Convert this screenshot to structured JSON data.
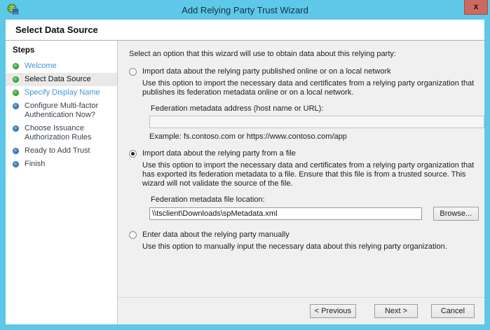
{
  "window": {
    "title": "Add Relying Party Trust Wizard",
    "close_label": "x",
    "page_header": "Select Data Source"
  },
  "sidebar": {
    "title": "Steps",
    "items": [
      {
        "label": "Welcome",
        "bullet": "green",
        "state": "link"
      },
      {
        "label": "Select Data Source",
        "bullet": "green",
        "state": "current"
      },
      {
        "label": "Specify Display Name",
        "bullet": "green",
        "state": "link"
      },
      {
        "label": "Configure Multi-factor Authentication Now?",
        "bullet": "blue",
        "state": "future"
      },
      {
        "label": "Choose Issuance Authorization Rules",
        "bullet": "blue",
        "state": "future"
      },
      {
        "label": "Ready to Add Trust",
        "bullet": "blue",
        "state": "future"
      },
      {
        "label": "Finish",
        "bullet": "blue",
        "state": "future"
      }
    ]
  },
  "main": {
    "intro": "Select an option that this wizard will use to obtain data about this relying party:",
    "option_online": {
      "label": "Import data about the relying party published online or on a local network",
      "description": "Use this option to import the necessary data and certificates from a relying party organization that publishes its federation metadata online or on a local network.",
      "field_label": "Federation metadata address (host name or URL):",
      "field_value": "",
      "example": "Example: fs.contoso.com or https://www.contoso.com/app",
      "selected": false
    },
    "option_file": {
      "label": "Import data about the relying party from a file",
      "description": "Use this option to import the necessary data and certificates from a relying party organization that has exported its federation metadata to a file. Ensure that this file is from a trusted source.  This wizard will not validate the source of the file.",
      "field_label": "Federation metadata file location:",
      "field_value": "\\\\tsclient\\Downloads\\spMetadata.xml",
      "browse_label": "Browse...",
      "selected": true
    },
    "option_manual": {
      "label": "Enter data about the relying party manually",
      "description": "Use this option to manually input the necessary data about this relying party organization.",
      "selected": false
    }
  },
  "footer": {
    "previous_label": "< Previous",
    "next_label": "Next >",
    "cancel_label": "Cancel"
  },
  "colors": {
    "titlebar": "#5EC8E9",
    "close_button": "#CB6A61",
    "link_blue": "#3E95D8",
    "bullet_green": "#3CA435",
    "bullet_blue": "#3277C4",
    "content_bg": "#F0F0F1",
    "current_step_bg": "#E9E9E9"
  }
}
